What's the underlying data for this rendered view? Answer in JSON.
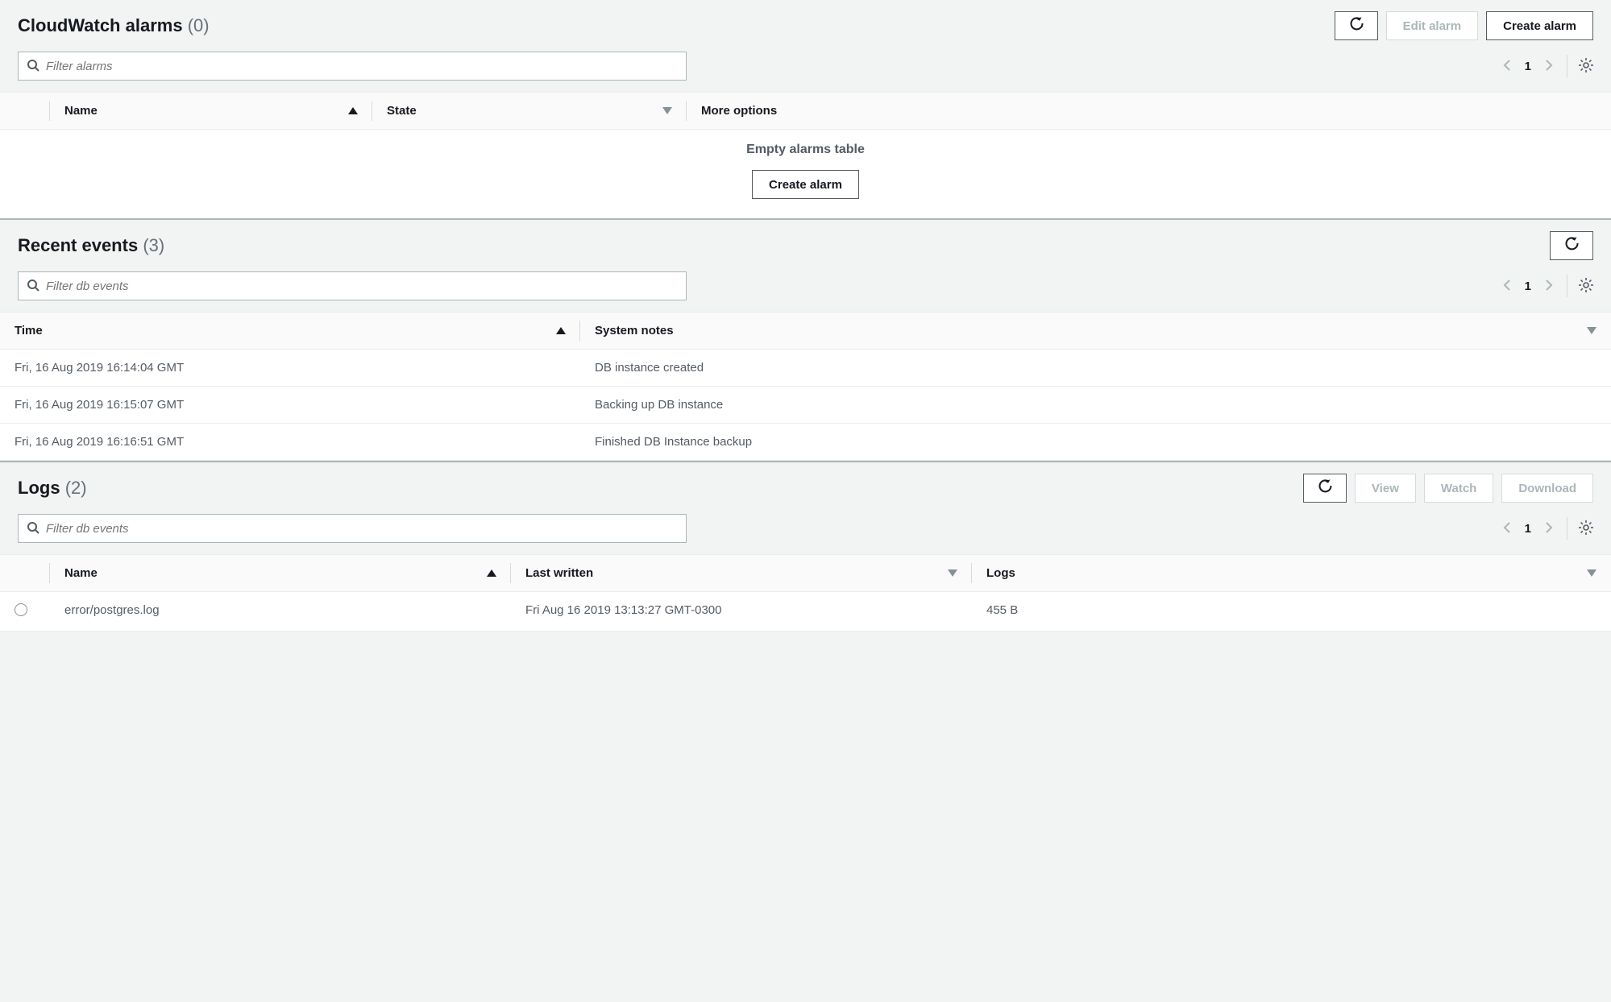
{
  "alarms": {
    "title": "CloudWatch alarms",
    "count": "(0)",
    "edit_button": "Edit alarm",
    "create_button": "Create alarm",
    "filter_placeholder": "Filter alarms",
    "page": "1",
    "columns": {
      "name": "Name",
      "state": "State",
      "more": "More options"
    },
    "empty_message": "Empty alarms table",
    "empty_action": "Create alarm"
  },
  "events": {
    "title": "Recent events",
    "count": "(3)",
    "filter_placeholder": "Filter db events",
    "page": "1",
    "columns": {
      "time": "Time",
      "notes": "System notes"
    },
    "rows": [
      {
        "time": "Fri, 16 Aug 2019 16:14:04 GMT",
        "notes": "DB instance created"
      },
      {
        "time": "Fri, 16 Aug 2019 16:15:07 GMT",
        "notes": "Backing up DB instance"
      },
      {
        "time": "Fri, 16 Aug 2019 16:16:51 GMT",
        "notes": "Finished DB Instance backup"
      }
    ]
  },
  "logs": {
    "title": "Logs",
    "count": "(2)",
    "view_button": "View",
    "watch_button": "Watch",
    "download_button": "Download",
    "filter_placeholder": "Filter db events",
    "page": "1",
    "columns": {
      "name": "Name",
      "written": "Last written",
      "size": "Logs"
    },
    "rows": [
      {
        "name": "error/postgres.log",
        "written": "Fri Aug 16 2019 13:13:27 GMT-0300",
        "size": "455 B"
      }
    ]
  }
}
